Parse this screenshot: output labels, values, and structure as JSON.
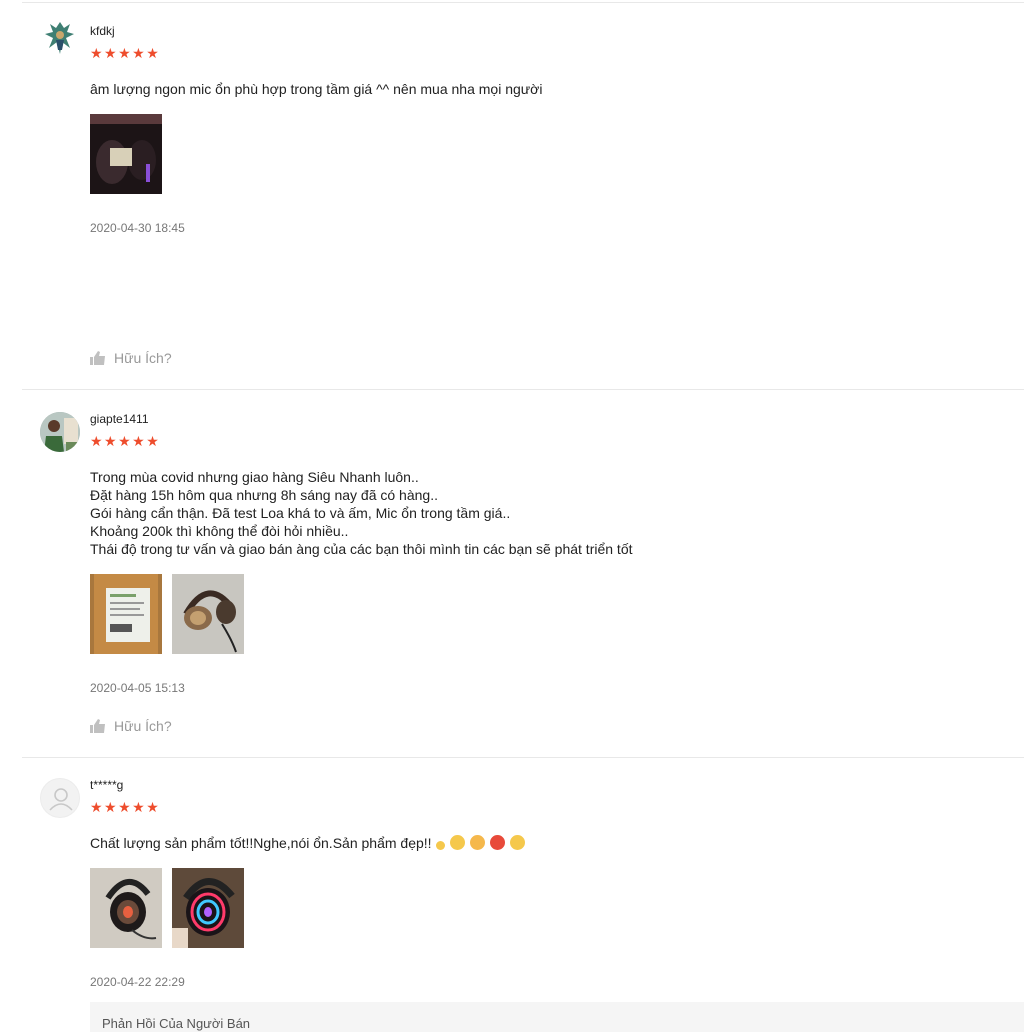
{
  "reviews": [
    {
      "author": "kfdkj",
      "stars": "★★★★★",
      "comment_lines": [
        "âm lượng ngon mic ổn phù hợp trong tầm giá ^^ nên mua nha mọi người"
      ],
      "time": "2020-04-30 18:45",
      "helpful": "Hữu Ích?"
    },
    {
      "author": "giapte1411",
      "stars": "★★★★★",
      "comment_lines": [
        "Trong mùa covid nhưng giao hàng Siêu Nhanh luôn..",
        "Đặt hàng 15h hôm qua nhưng 8h sáng nay đã có hàng..",
        "Gói hàng cẩn thận. Đã test Loa khá to và ấm, Mic ổn trong tầm giá..",
        "Khoảng 200k thì không thể đòi hỏi nhiều..",
        "Thái độ trong tư vấn và giao bán àng của các bạn thôi mình tin các bạn sẽ phát triển tốt"
      ],
      "time": "2020-04-05 15:13",
      "helpful": "Hữu Ích?"
    },
    {
      "author": "t*****g",
      "stars": "★★★★★",
      "comment_lines": [
        "Chất lượng sản phẩm tốt!!Nghe,nói ổn.Sản phẩm đẹp!!"
      ],
      "time": "2020-04-22 22:29",
      "seller_reply": "Phản Hồi Của Người Bán"
    }
  ],
  "colors": {
    "star": "#ee4d2d",
    "divider": "#e8e8e8",
    "muted": "#999999"
  },
  "icons": [
    "thumbs-up-icon",
    "user-placeholder-icon",
    "emoji-icon"
  ]
}
